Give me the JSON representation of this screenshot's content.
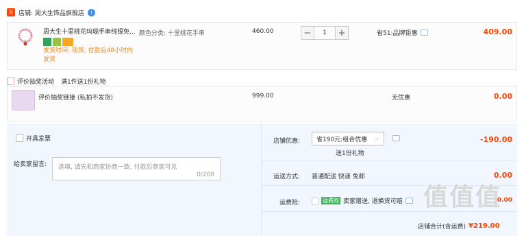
{
  "shop": {
    "icon_text": "tmall-icon",
    "name": "店铺: 周大生饰品旗舰店",
    "chat_badge": "i"
  },
  "item1": {
    "title": "周大生十里桃花玛瑙手串纯银免...",
    "variant": "颜色分类: 十里桃花手串",
    "shipping": "发货时间: 现货, 付款后48小时内发货",
    "unit_price": "460.00",
    "quantity": "1",
    "minus": "−",
    "plus": "+",
    "promo": "省51:品牌钜惠",
    "total": "409.00"
  },
  "gift": {
    "activity_label": "评价抽奖活动",
    "activity_detail": "满1件送1份礼物",
    "title": "评价抽奖链接 (私拍不发货)",
    "unit_price": "999.00",
    "promo": "无优惠",
    "total": "0.00"
  },
  "anon": {
    "label": "开具发票"
  },
  "remark": {
    "label": "给卖家留言:",
    "placeholder": "选填, 请先和商家协商一致, 付款后商家可见",
    "counter": "0/200"
  },
  "coupon": {
    "label": "店铺优惠:",
    "selected": "省190元:组合优惠",
    "sub": "送1份礼物",
    "amount": "-190.00"
  },
  "delivery": {
    "label": "运送方式:",
    "value": "普通配送 快递 免邮",
    "amount": "0.00"
  },
  "insurance": {
    "label": "运费险:",
    "badge": "运费险",
    "value": "卖家赠送, 退换货可赔",
    "amount": "0.00"
  },
  "footer": {
    "label": "店铺合计(含运费)",
    "amount": "¥219.00"
  },
  "watermark": "值值值"
}
